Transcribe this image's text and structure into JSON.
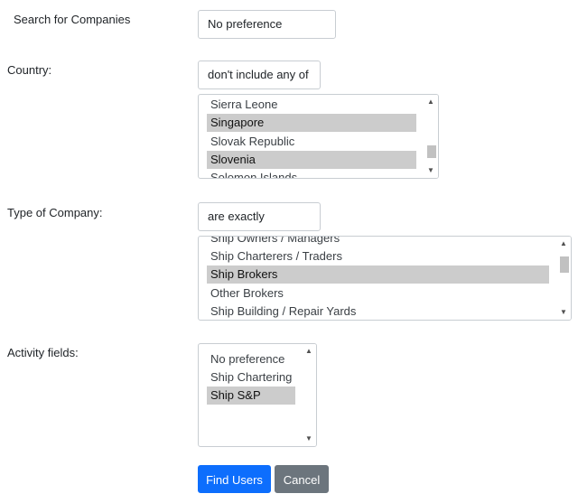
{
  "search": {
    "label": "Search for Companies",
    "value": "No preference"
  },
  "country": {
    "label": "Country:",
    "mode": "don't include any of",
    "options": [
      {
        "text": "Sierra Leone",
        "selected": false
      },
      {
        "text": "Singapore",
        "selected": true
      },
      {
        "text": "Slovak Republic",
        "selected": false
      },
      {
        "text": "Slovenia",
        "selected": true
      },
      {
        "text": "Solomon Islands",
        "selected": false
      }
    ]
  },
  "company_type": {
    "label": "Type of Company:",
    "mode": "are exactly",
    "options": [
      {
        "text": "Ship Owners / Managers",
        "selected": false
      },
      {
        "text": "Ship Charterers / Traders",
        "selected": false
      },
      {
        "text": "Ship Brokers",
        "selected": true
      },
      {
        "text": "Other Brokers",
        "selected": false
      },
      {
        "text": "Ship Building / Repair Yards",
        "selected": false
      }
    ]
  },
  "activity": {
    "label": "Activity fields:",
    "options": [
      {
        "text": "No preference",
        "selected": false
      },
      {
        "text": "Ship Chartering",
        "selected": false
      },
      {
        "text": "Ship S&P",
        "selected": true
      }
    ]
  },
  "buttons": {
    "find": "Find Users",
    "cancel": "Cancel"
  },
  "colors": {
    "primary": "#0d6efd",
    "secondary": "#6c757d",
    "selected_option": "#cccccc"
  }
}
